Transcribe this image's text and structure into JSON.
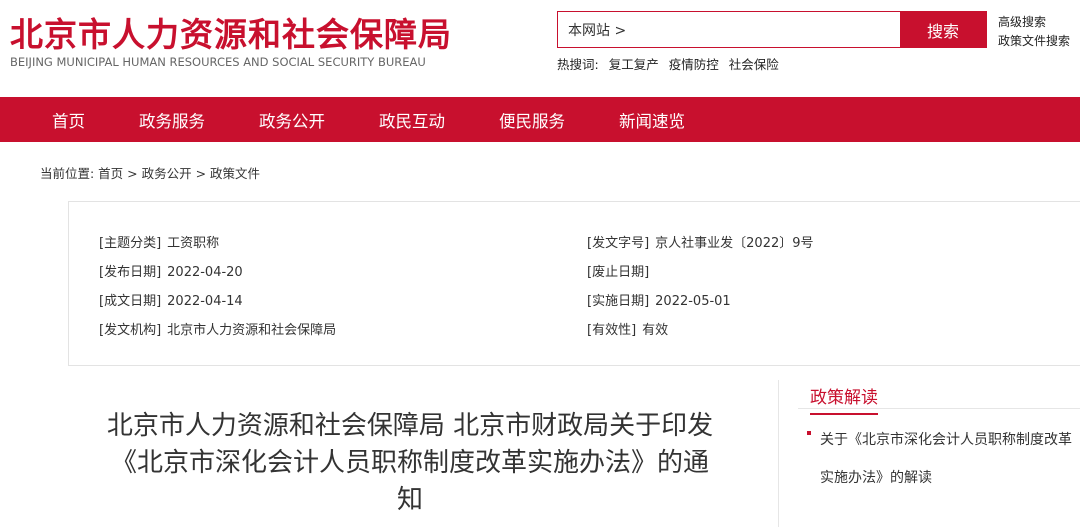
{
  "header": {
    "title_cn": "北京市人力资源和社会保障局",
    "title_en": "BEIJING MUNICIPAL HUMAN RESOURCES AND SOCIAL SECURITY BUREAU",
    "search": {
      "value": "本网站 >",
      "button_label": "搜索"
    },
    "advanced_search": "高级搜索",
    "policy_search": "政策文件搜索",
    "hot_label": "热搜词:",
    "hot_words": [
      "复工复产",
      "疫情防控",
      "社会保险"
    ]
  },
  "nav": {
    "items": [
      "首页",
      "政务服务",
      "政务公开",
      "政民互动",
      "便民服务",
      "新闻速览"
    ]
  },
  "breadcrumb": "当前位置:  首页 > 政务公开 > 政策文件",
  "meta": {
    "topic": {
      "key": "[主题分类]",
      "value": "工资职称"
    },
    "doc_no": {
      "key": "[发文字号]",
      "value": "京人社事业发〔2022〕9号"
    },
    "publish_date": {
      "key": "[发布日期]",
      "value": "2022-04-20"
    },
    "expire_date": {
      "key": "[废止日期]",
      "value": ""
    },
    "created_date": {
      "key": "[成文日期]",
      "value": "2022-04-14"
    },
    "effective_date": {
      "key": "[实施日期]",
      "value": "2022-05-01"
    },
    "issuer": {
      "key": "[发文机构]",
      "value": "北京市人力资源和社会保障局"
    },
    "validity": {
      "key": "[有效性]",
      "value": "有效"
    }
  },
  "article": {
    "title": "北京市人力资源和社会保障局 北京市财政局关于印发《北京市深化会计人员职称制度改革实施办法》的通知"
  },
  "sidebar": {
    "title": "政策解读",
    "links": [
      "关于《北京市深化会计人员职称制度改革实施办法》的解读"
    ]
  },
  "colors": {
    "brand": "#c8102e"
  }
}
